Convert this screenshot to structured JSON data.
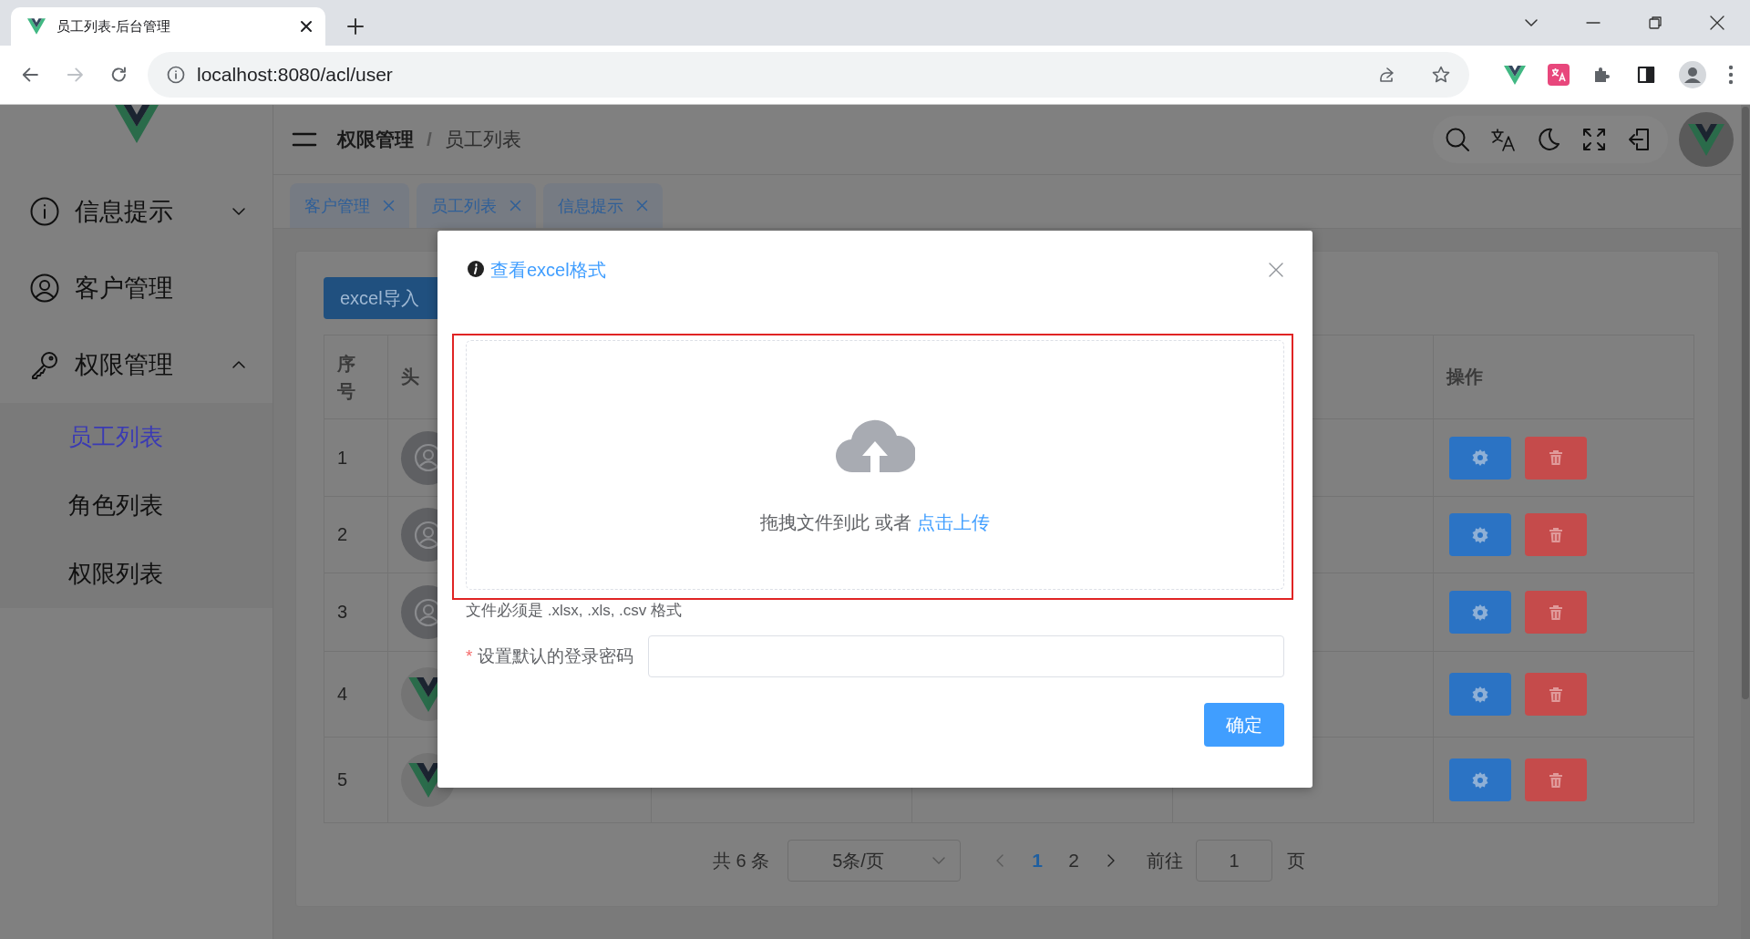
{
  "browser": {
    "tab_title": "员工列表-后台管理",
    "url": "localhost:8080/acl/user",
    "forward_disabled": true
  },
  "sidebar": {
    "items": [
      {
        "label": "信息提示",
        "expanded": false
      },
      {
        "label": "客户管理"
      },
      {
        "label": "权限管理",
        "expanded": true,
        "children": [
          {
            "label": "员工列表",
            "selected": true
          },
          {
            "label": "角色列表",
            "selected": false
          },
          {
            "label": "权限列表",
            "selected": false
          }
        ]
      }
    ]
  },
  "header": {
    "breadcrumb": [
      "权限管理",
      "员工列表"
    ],
    "breadcrumb_separator": "/"
  },
  "tags": [
    {
      "label": "客户管理"
    },
    {
      "label": "员工列表"
    },
    {
      "label": "信息提示"
    }
  ],
  "toolbar": {
    "import_button": "excel导入"
  },
  "table": {
    "columns": [
      "序号",
      "头",
      "操作"
    ],
    "rows": [
      {
        "no": "1",
        "avatar": {
          "kind": "default"
        }
      },
      {
        "no": "2",
        "avatar": {
          "kind": "default"
        }
      },
      {
        "no": "3",
        "avatar": {
          "kind": "default"
        }
      },
      {
        "no": "4",
        "avatar": {
          "kind": "logo"
        }
      },
      {
        "no": "5",
        "avatar": {
          "kind": "logo"
        }
      }
    ]
  },
  "pagination": {
    "total": "共 6 条",
    "page_size": "5条/页",
    "pages": [
      {
        "label": "1",
        "selected": true
      },
      {
        "label": "2",
        "selected": false
      }
    ],
    "goto_label": "前往",
    "goto_value": "1",
    "goto_suffix": "页"
  },
  "dialog": {
    "format_link": "查看excel格式",
    "upload_text": "拖拽文件到此 或者",
    "upload_link": "点击上传",
    "tip": "文件必须是 .xlsx, .xls, .csv 格式",
    "required_mark": "*",
    "password_label": "设置默认的登录密码",
    "confirm_button": "确定"
  }
}
